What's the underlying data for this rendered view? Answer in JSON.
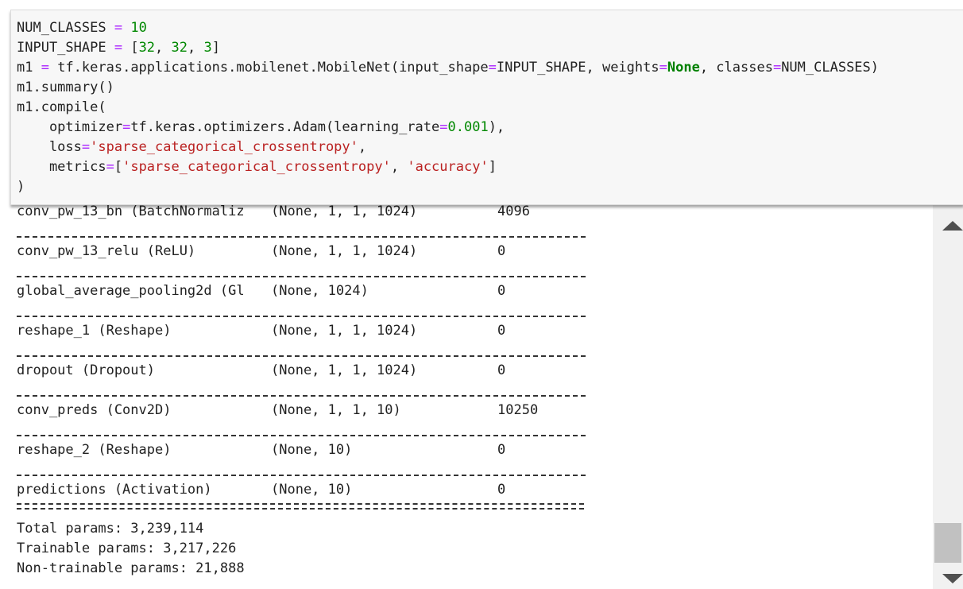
{
  "code": {
    "line1": {
      "a": "NUM_CLASSES ",
      "b": "=",
      "c": " ",
      "d": "10"
    },
    "line2": {
      "a": "INPUT_SHAPE ",
      "b": "=",
      "c": " [",
      "d": "32",
      "e": ", ",
      "f": "32",
      "g": ", ",
      "h": "3",
      "i": "]"
    },
    "line3": {
      "a": "m1 ",
      "b": "=",
      "c": " tf.keras.applications.mobilenet.MobileNet(input_shape",
      "d": "=",
      "e": "INPUT_SHAPE, weights",
      "f": "=",
      "g": "None",
      "h": ", classes",
      "i": "=",
      "j": "NUM_CLASSES)"
    },
    "line4": "m1.summary()",
    "line5": "m1.compile(",
    "line6": {
      "a": "    optimizer",
      "b": "=",
      "c": "tf.keras.optimizers.Adam(learning_rate",
      "d": "=",
      "e": "0.001",
      "f": "),"
    },
    "line7": {
      "a": "    loss",
      "b": "=",
      "c": "'sparse_categorical_crossentropy'",
      "d": ","
    },
    "line8": {
      "a": "    metrics",
      "b": "=",
      "c": "[",
      "d": "'sparse_categorical_crossentropy'",
      "e": ", ",
      "f": "'accuracy'",
      "g": "]"
    },
    "line9": ")"
  },
  "summary": {
    "rows": [
      {
        "name": "conv_pw_13_bn (BatchNormaliz",
        "shape": "(None, 1, 1, 1024)",
        "params": "4096"
      },
      {
        "name": "conv_pw_13_relu (ReLU)",
        "shape": "(None, 1, 1, 1024)",
        "params": "0"
      },
      {
        "name": "global_average_pooling2d (Gl",
        "shape": "(None, 1024)",
        "params": "0"
      },
      {
        "name": "reshape_1 (Reshape)",
        "shape": "(None, 1, 1, 1024)",
        "params": "0"
      },
      {
        "name": "dropout (Dropout)",
        "shape": "(None, 1, 1, 1024)",
        "params": "0"
      },
      {
        "name": "conv_preds (Conv2D)",
        "shape": "(None, 1, 1, 10)",
        "params": "10250"
      },
      {
        "name": "reshape_2 (Reshape)",
        "shape": "(None, 10)",
        "params": "0"
      },
      {
        "name": "predictions (Activation)",
        "shape": "(None, 10)",
        "params": "0"
      }
    ],
    "total": "Total params: 3,239,114",
    "trainable": "Trainable params: 3,217,226",
    "non_trainable": "Non-trainable params: 21,888"
  },
  "colors": {
    "operator": "#aa22ff",
    "number": "#008800",
    "string": "#ba2121",
    "keyword": "#008000"
  },
  "icons": {
    "scroll_up": "triangle-up-icon",
    "scroll_down": "triangle-down-icon"
  }
}
